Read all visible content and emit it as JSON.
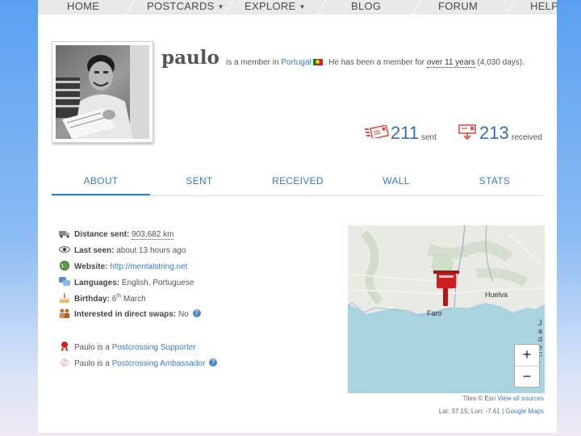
{
  "nav": {
    "home": "HOME",
    "postcards": "POSTCARDS",
    "explore": "EXPLORE",
    "blog": "BLOG",
    "forum": "FORUM",
    "help": "HELP"
  },
  "profile": {
    "username": "paulo",
    "member_prefix": "is a member in",
    "country": "Portugal",
    "member_mid": ". He has been a member for",
    "duration": "over 11 years",
    "days": "(4,030 days)."
  },
  "stats": {
    "sent_count": "211",
    "sent_label": "sent",
    "received_count": "213",
    "received_label": "received"
  },
  "tabs": [
    "ABOUT",
    "SENT",
    "RECEIVED",
    "WALL",
    "STATS"
  ],
  "info": {
    "distance_label": "Distance sent:",
    "distance_value": "903,682 km",
    "lastseen_label": "Last seen:",
    "lastseen_value": "about 13 hours ago",
    "website_label": "Website:",
    "website_value": "http://mentalstring.net",
    "languages_label": "Languages:",
    "languages_value": "English, Portuguese",
    "birthday_label": "Birthday:",
    "birthday_day": "6",
    "birthday_sup": "th",
    "birthday_month": "March",
    "swaps_label": "Interested in direct swaps:",
    "swaps_value": "No",
    "supporter_prefix": "Paulo is a",
    "supporter_link": "Postcrossing Supporter",
    "ambassador_prefix": "Paulo is a",
    "ambassador_link": "Postcrossing Ambassador"
  },
  "map": {
    "label_huelva": "Huelva",
    "label_faro": "Faro",
    "label_edge": "Ja de Fr",
    "zoom_in": "+",
    "zoom_out": "−",
    "tiles_prefix": "Tiles © Esri",
    "tiles_link": "View all sources",
    "coords": "Lat: 37.15, Lon: -7.61 |",
    "maps_link": "Google Maps"
  },
  "colors": {
    "link": "#3a7cc0",
    "nav_bg": "#e9e9e9",
    "stat_icon": "#d9534f",
    "mailbox": "#cc1f1f"
  }
}
